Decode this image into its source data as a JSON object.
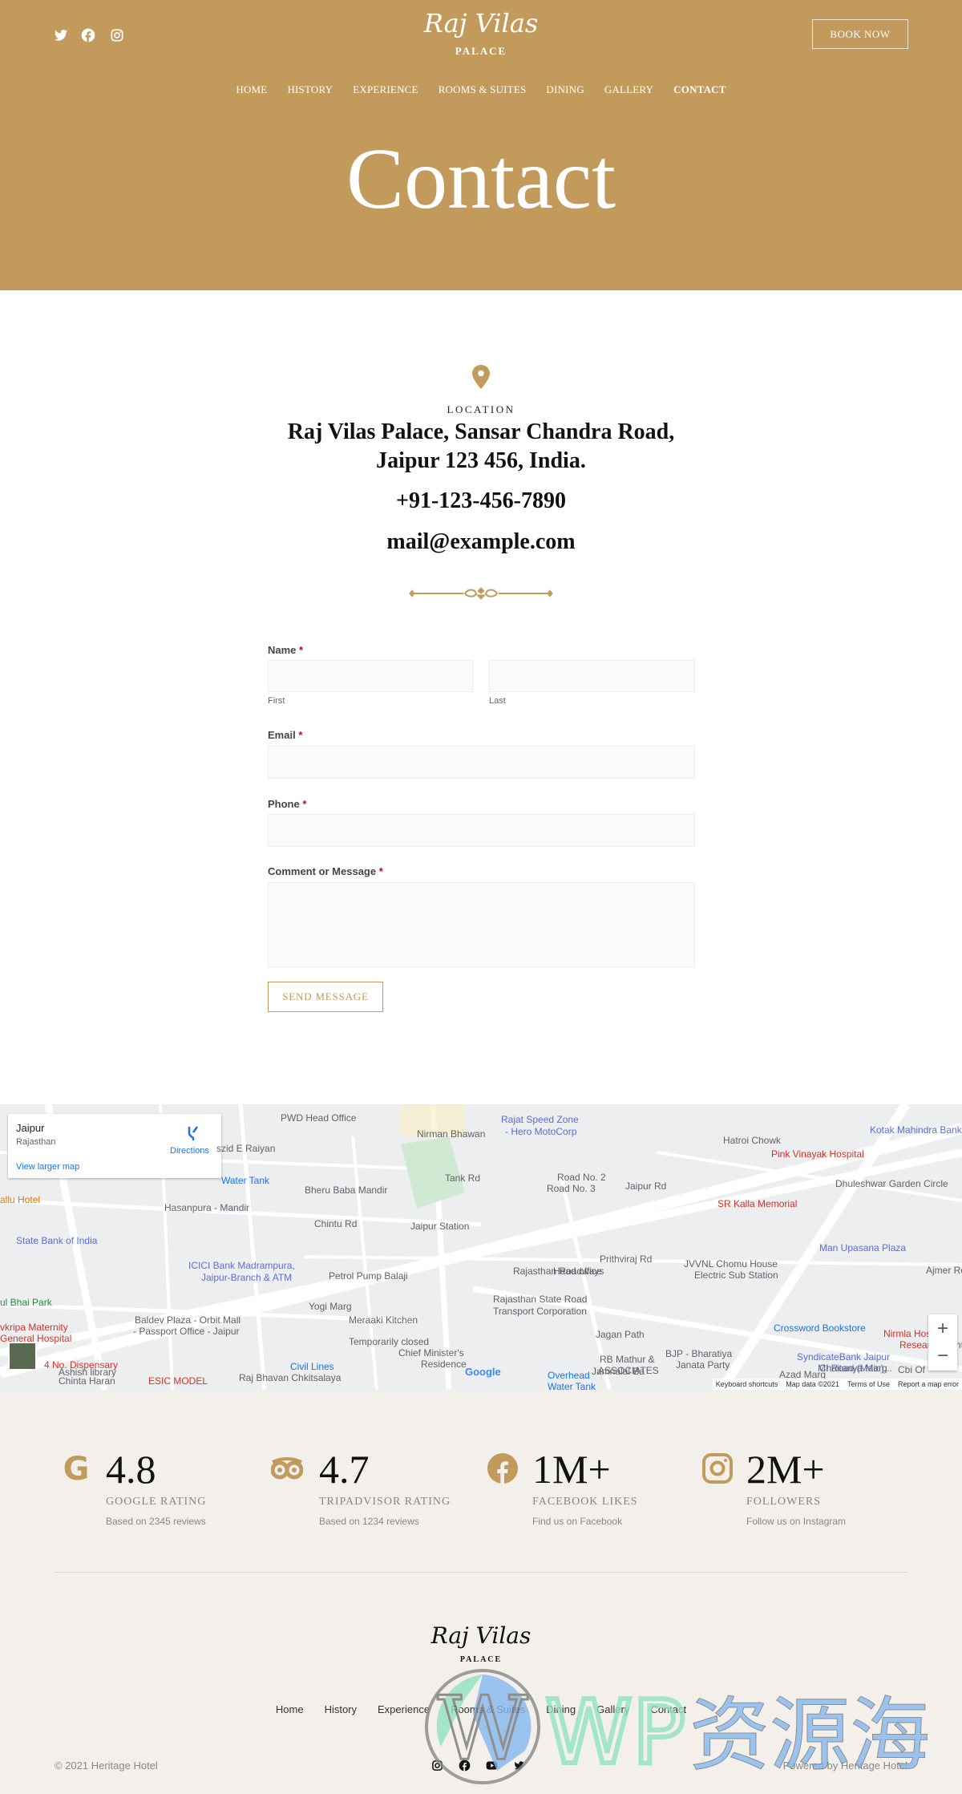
{
  "colors": {
    "brand": "#C29A5C",
    "footer_bg": "#F3EFEA",
    "required": "#d0021b"
  },
  "header": {
    "social": [
      {
        "icon": "twitter-icon"
      },
      {
        "icon": "facebook-icon"
      },
      {
        "icon": "instagram-icon"
      }
    ],
    "logo": {
      "name": "Raj Vilas",
      "tagline": "PALACE"
    },
    "book_now": "BOOK NOW",
    "nav": [
      "HOME",
      "HISTORY",
      "EXPERIENCE",
      "ROOMS & SUITES",
      "DINING",
      "GALLERY",
      "CONTACT"
    ],
    "active_nav": "CONTACT",
    "title": "Contact"
  },
  "contact": {
    "icon": "map-pin-icon",
    "eyebrow": "LOCATION",
    "address_line1": "Raj Vilas Palace, Sansar Chandra Road,",
    "address_line2": "Jaipur 123 456, India.",
    "phone": "+91-123-456-7890",
    "email": "mail@example.com"
  },
  "form": {
    "name_label": "Name",
    "first": "First",
    "last": "Last",
    "email_label": "Email",
    "phone_label": "Phone",
    "message_label": "Comment or Message",
    "required_mark": "*",
    "submit": "SEND MESSAGE"
  },
  "map": {
    "card": {
      "title": "Jaipur",
      "subtitle": "Rajasthan",
      "directions": "Directions",
      "larger": "View larger map"
    },
    "labels": [
      "PWD Head Office",
      "Nirman Bhawan",
      "szid E Raiyan",
      "Water Tank",
      "Bheru Baba Mandir",
      "Hasanpura - Mandir",
      "allu Hotel",
      "State Bank of India",
      "ICICI Bank Madrampura,",
      "Jaipur-Branch & ATM",
      "Petrol Pump Balaji",
      "Jaipur Station",
      "Tank Rd",
      "Chintu Rd",
      "ul Bhai Park",
      "Baldev Plaza - Orbit Mall",
      "- Passport Office - Jaipur",
      "Meraaki Kitchen",
      "Temporarily closed",
      "vkripa Maternity",
      "General Hospital",
      "Ashish library",
      "Civil Lines",
      "Chief Minister's",
      "Residence",
      "4 No. Dispensary",
      "Chinta Haran",
      "Raj Bhavan Chkitsalaya",
      "ESIC MODEL",
      "Rajat Speed Zone",
      "- Hero MotoCorp",
      "Jaipur Rd",
      "Ajmer Rd",
      "Hatroi Chowk",
      "Kotak Mahindra Bank",
      "Pink Vinayak Hospital",
      "SR Kalla Memorial",
      "Dhuleshwar Garden Circle",
      "Man Upasana Plaza",
      "JVVNL Chomu House",
      "Electric Sub Station",
      "Prithviraj Rd",
      "Rajasthan Roadways",
      "Head office",
      "Rajasthan State Road",
      "Transport Corporation",
      "Jagan Path",
      "RB Mathur &",
      "ASSOCIATES",
      "Overhead",
      "Water Tank",
      "BJP - Bharatiya",
      "Janata Party",
      "Crossword Bookstore",
      "Nirmla Hospital A",
      "Research Cent",
      "SyndicateBank Jaipur",
      "MI Road (Main)...",
      "Cbi Of",
      "Chaitanya Marg",
      "Azad Marg",
      "Yogi Marg",
      "Road No. 2",
      "Road No. 3",
      "Jamnalal Ba"
    ],
    "zoom_in": "+",
    "zoom_out": "−",
    "footer": [
      "Keyboard shortcuts",
      "Map data ©2021",
      "Terms of Use",
      "Report a map error"
    ],
    "google": "Google"
  },
  "stats": [
    {
      "icon": "google-icon",
      "value": "4.8",
      "label": "GOOGLE RATING",
      "sub": "Based on 2345 reviews"
    },
    {
      "icon": "tripadvisor-icon",
      "value": "4.7",
      "label": "TRIPADVISOR RATING",
      "sub": "Based on 1234 reviews"
    },
    {
      "icon": "facebook-icon",
      "value": "1M+",
      "label": "FACEBOOK LIKES",
      "sub": "Find us on Facebook"
    },
    {
      "icon": "instagram-icon",
      "value": "2M+",
      "label": "FOLLOWERS",
      "sub": "Follow us on Instagram"
    }
  ],
  "footer": {
    "logo": {
      "name": "Raj Vilas",
      "tagline": "PALACE"
    },
    "nav": [
      "Home",
      "History",
      "Experience",
      "Rooms & Suites",
      "Dining",
      "Gallery",
      "Contact"
    ],
    "copyright": "© 2021 Heritage Hotel",
    "social": [
      {
        "icon": "instagram-icon"
      },
      {
        "icon": "facebook-icon"
      },
      {
        "icon": "youtube-icon"
      },
      {
        "icon": "twitter-icon"
      }
    ],
    "powered": "Powered by Heritage Hotel"
  },
  "watermark": "WP资源海"
}
